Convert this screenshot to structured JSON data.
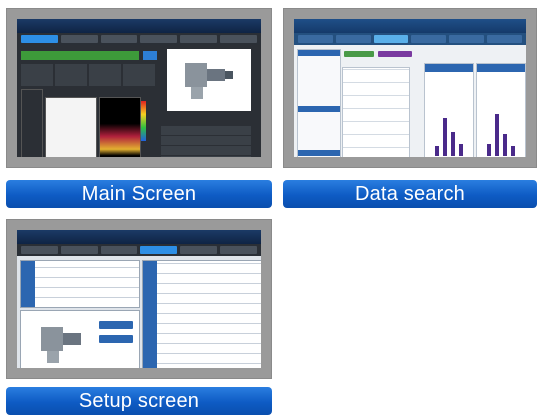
{
  "cards": [
    {
      "name": "main",
      "caption": "Main Screen"
    },
    {
      "name": "search",
      "caption": "Data search"
    },
    {
      "name": "setup",
      "caption": "Setup screen"
    }
  ],
  "colors": {
    "caption_blue": "#0e5bc4",
    "frame_gray": "#9a9a9a"
  }
}
